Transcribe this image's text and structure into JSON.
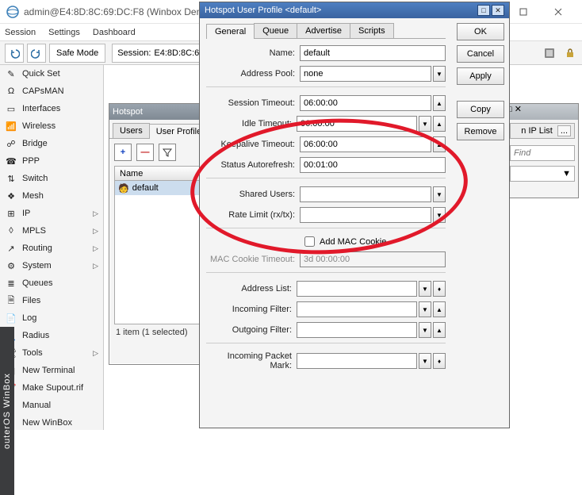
{
  "window": {
    "title": "admin@E4:8D:8C:69:DC:F8 (Winbox Demo - winbox_(tutorial)) - WinBox v6.30.4 on hAP lite (smips)"
  },
  "menubar": [
    "Session",
    "Settings",
    "Dashboard"
  ],
  "toolbar": {
    "safemode": "Safe Mode",
    "session_label": "Session:",
    "session_value": "E4:8D:8C:69:DC:F8"
  },
  "sidebar": {
    "items": [
      {
        "label": "Quick Set",
        "icon": "wand"
      },
      {
        "label": "CAPsMAN",
        "icon": "caps"
      },
      {
        "label": "Interfaces",
        "icon": "iface"
      },
      {
        "label": "Wireless",
        "icon": "wifi"
      },
      {
        "label": "Bridge",
        "icon": "bridge"
      },
      {
        "label": "PPP",
        "icon": "ppp"
      },
      {
        "label": "Switch",
        "icon": "switch"
      },
      {
        "label": "Mesh",
        "icon": "mesh"
      },
      {
        "label": "IP",
        "icon": "ip",
        "sub": true
      },
      {
        "label": "MPLS",
        "icon": "mpls",
        "sub": true
      },
      {
        "label": "Routing",
        "icon": "route",
        "sub": true
      },
      {
        "label": "System",
        "icon": "gear",
        "sub": true
      },
      {
        "label": "Queues",
        "icon": "queue"
      },
      {
        "label": "Files",
        "icon": "files"
      },
      {
        "label": "Log",
        "icon": "log"
      },
      {
        "label": "Radius",
        "icon": "radius"
      },
      {
        "label": "Tools",
        "icon": "tools",
        "sub": true
      },
      {
        "label": "New Terminal",
        "icon": "term"
      },
      {
        "label": "Make Supout.rif",
        "icon": "supout"
      },
      {
        "label": "Manual",
        "icon": "manual"
      },
      {
        "label": "New WinBox",
        "icon": "nbox"
      }
    ],
    "vtab": "outerOS WinBox"
  },
  "hotspot": {
    "title": "Hotspot",
    "tabs": [
      "Users",
      "User Profiles"
    ],
    "active_tab": 1,
    "list_header": "Name",
    "rows": [
      {
        "name": "default"
      }
    ],
    "status": "1 item (1 selected)",
    "btn_plus": "+",
    "btn_minus": "—"
  },
  "rightwin": {
    "tab_label": "n IP List",
    "dots": "...",
    "find_placeholder": "Find"
  },
  "dialog": {
    "title": "Hotspot User Profile <default>",
    "tabs": [
      "General",
      "Queue",
      "Advertise",
      "Scripts"
    ],
    "active_tab": 0,
    "buttons": {
      "ok": "OK",
      "cancel": "Cancel",
      "apply": "Apply",
      "copy": "Copy",
      "remove": "Remove"
    },
    "fields": {
      "name_label": "Name:",
      "name": "default",
      "addrpool_label": "Address Pool:",
      "addrpool": "none",
      "sess_to_label": "Session Timeout:",
      "sess_to": "06:00:00",
      "idle_to_label": "Idle Timeout:",
      "idle_to": "06:00:00",
      "keep_to_label": "Keepalive Timeout:",
      "keep_to": "06:00:00",
      "status_ar_label": "Status Autorefresh:",
      "status_ar": "00:01:00",
      "shared_label": "Shared Users:",
      "shared": "",
      "rate_label": "Rate Limit (rx/tx):",
      "rate": "",
      "addmac_label": "Add MAC Cookie",
      "maccookie_label": "MAC Cookie Timeout:",
      "maccookie": "3d 00:00:00",
      "addrlist_label": "Address List:",
      "addrlist": "",
      "infilter_label": "Incoming Filter:",
      "infilter": "",
      "outfilter_label": "Outgoing Filter:",
      "outfilter": "",
      "inpktmark_label": "Incoming Packet Mark:",
      "inpktmark": ""
    }
  }
}
